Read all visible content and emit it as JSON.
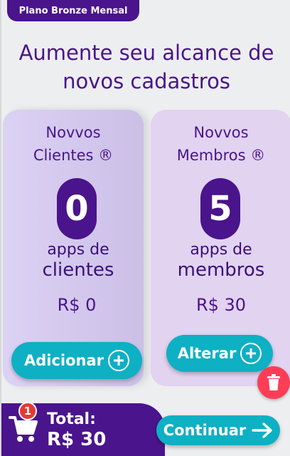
{
  "plan_badge": "Plano Bronze Mensal",
  "headline": {
    "line1": "Aumente seu alcance de",
    "line2": "novos cadastros"
  },
  "cards": [
    {
      "title_line1": "Novvos",
      "title_line2": "Clientes ®",
      "count": "0",
      "apps_prefix": "apps de",
      "apps_type": "clientes",
      "price": "R$ 0",
      "button_label": "Adicionar"
    },
    {
      "title_line1": "Novvos",
      "title_line2": "Membros ®",
      "count": "5",
      "apps_prefix": "apps de",
      "apps_type": "membros",
      "price": "R$ 30",
      "button_label": "Alterar"
    }
  ],
  "footer": {
    "cart_count": "1",
    "total_label": "Total:",
    "total_value": "R$ 30",
    "continue_label": "Continuar"
  },
  "icons": {
    "cart": "cart-icon",
    "trash": "trash-icon",
    "plus": "plus-circle-icon",
    "arrow": "arrow-right-icon"
  },
  "colors": {
    "primary": "#4a148c",
    "accent": "#0eb0c4",
    "danger": "#ff3d57"
  }
}
